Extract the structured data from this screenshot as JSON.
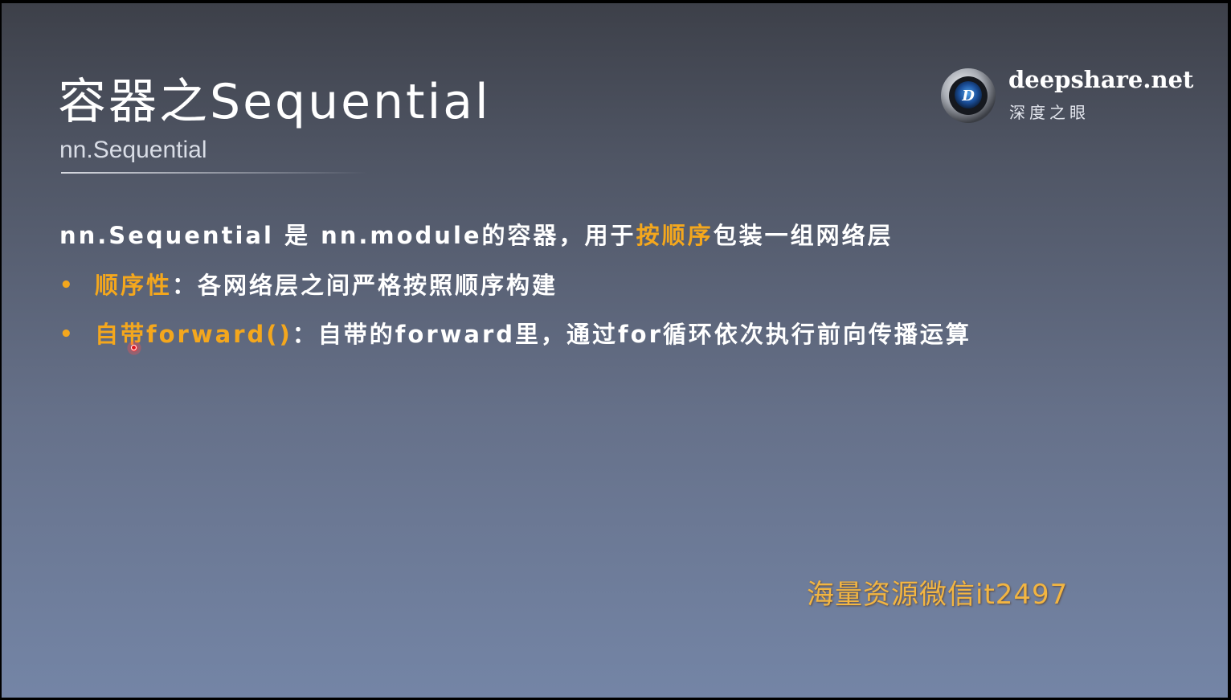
{
  "slide": {
    "title": "容器之Sequential",
    "subtitle": "nn.Sequential"
  },
  "logo": {
    "name": "deepshare.net",
    "subtitle": "深度之眼",
    "icon_letter": "D",
    "icon": "eye-logo-icon"
  },
  "content": {
    "line1": {
      "part1": "nn.Sequential 是 nn.module的容器，用于",
      "highlight": "按顺序",
      "part2": "包装一组网络层"
    },
    "bullet1": {
      "marker": "•",
      "highlight": "顺序性",
      "text": "：各网络层之间严格按照顺序构建"
    },
    "bullet2": {
      "marker": "•",
      "highlight": "自带forward()",
      "text": "：自带的forward里，通过for循环依次执行前向传播运算"
    }
  },
  "watermark": "海量资源微信it2497",
  "colors": {
    "highlight": "#f4a71d",
    "text": "#ffffff",
    "watermark": "#f2b542",
    "pointer": "#e0141c"
  }
}
